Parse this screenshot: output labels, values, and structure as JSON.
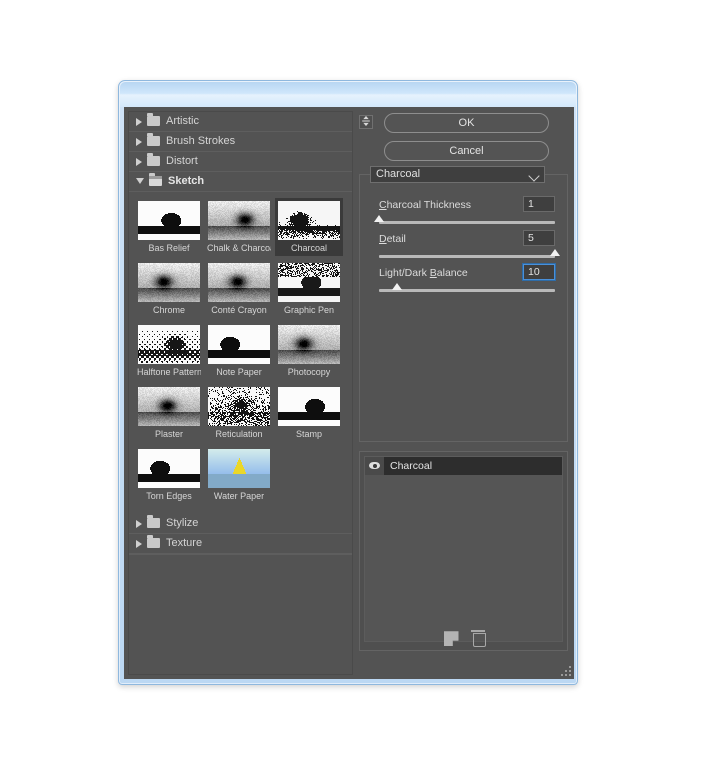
{
  "window": {
    "titlebar_color": "#cfe6fb",
    "dialog_bg": "#535353"
  },
  "categories": [
    {
      "label": "Artistic",
      "expanded": false
    },
    {
      "label": "Brush Strokes",
      "expanded": false
    },
    {
      "label": "Distort",
      "expanded": false
    },
    {
      "label": "Sketch",
      "expanded": true
    }
  ],
  "categories_bottom": [
    {
      "label": "Stylize",
      "expanded": false
    },
    {
      "label": "Texture",
      "expanded": false
    }
  ],
  "filters": [
    {
      "label": "Bas Relief",
      "selected": false
    },
    {
      "label": "Chalk & Charcoal",
      "selected": false
    },
    {
      "label": "Charcoal",
      "selected": true
    },
    {
      "label": "Chrome",
      "selected": false
    },
    {
      "label": "Conté Crayon",
      "selected": false
    },
    {
      "label": "Graphic Pen",
      "selected": false
    },
    {
      "label": "Halftone Pattern",
      "selected": false
    },
    {
      "label": "Note Paper",
      "selected": false
    },
    {
      "label": "Photocopy",
      "selected": false
    },
    {
      "label": "Plaster",
      "selected": false
    },
    {
      "label": "Reticulation",
      "selected": false
    },
    {
      "label": "Stamp",
      "selected": false
    },
    {
      "label": "Torn Edges",
      "selected": false
    },
    {
      "label": "Water Paper",
      "selected": false
    }
  ],
  "buttons": {
    "ok": "OK",
    "cancel": "Cancel",
    "panel_toggle_icon": "collapse-panel-icon"
  },
  "filter_select": {
    "value": "Charcoal",
    "chevron_icon": "chevron-down-icon"
  },
  "params": [
    {
      "label_prefix": "C",
      "label_rest": "harcoal Thickness",
      "value": "1",
      "percent": 0,
      "focused": false
    },
    {
      "label_prefix": "D",
      "label_rest": "etail",
      "value": "5",
      "percent": 100,
      "focused": false
    },
    {
      "label_prefix": "Light/Dark ",
      "label_rest": "Balance",
      "value": "10",
      "percent": 10,
      "focused": true,
      "underline_char": "B"
    }
  ],
  "layers": {
    "rows": [
      {
        "name": "Charcoal",
        "visible": true,
        "eye_icon": "eye-icon"
      }
    ],
    "tools": [
      {
        "name": "new-effect-layer-icon",
        "label": ""
      },
      {
        "name": "delete-effect-layer-icon",
        "label": ""
      }
    ]
  },
  "accent_color": "#4a90d9"
}
